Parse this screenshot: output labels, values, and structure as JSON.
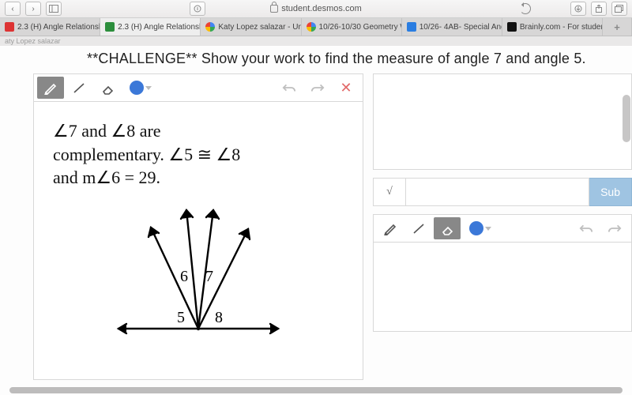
{
  "domain": "Computer-Use",
  "browser": {
    "url_host": "student.desmos.com",
    "tabs": [
      {
        "fav": "red",
        "label": "2.3 (H) Angle Relationshi..."
      },
      {
        "fav": "grn",
        "label": "2.3 (H) Angle Relationshi...",
        "active": true
      },
      {
        "fav": "ggl",
        "label": "Katy Lopez salazar - Unit..."
      },
      {
        "fav": "ggl",
        "label": "10/26-10/30 Geometry W..."
      },
      {
        "fav": "doc",
        "label": "10/26- 4AB- Special Angl..."
      },
      {
        "fav": "blk",
        "label": "Brainly.com - For student..."
      }
    ]
  },
  "crumb": "aty Lopez salazar",
  "prompt": "**CHALLENGE** Show your work to find the measure of angle 7 and angle 5.",
  "problem": {
    "line1_a": "∠7 and ∠8 are",
    "line2_a": "complementary. ∠5 ≅ ∠8",
    "line3_a": "and m∠6 = 29.",
    "labels": {
      "a": "6",
      "b": "7",
      "c": "5",
      "d": "8"
    }
  },
  "right": {
    "math_btn": "√",
    "submit": "Sub"
  },
  "toolbar": {
    "tools": [
      "pencil",
      "line",
      "eraser",
      "color"
    ],
    "selected_left": "pencil",
    "selected_right": "eraser"
  }
}
